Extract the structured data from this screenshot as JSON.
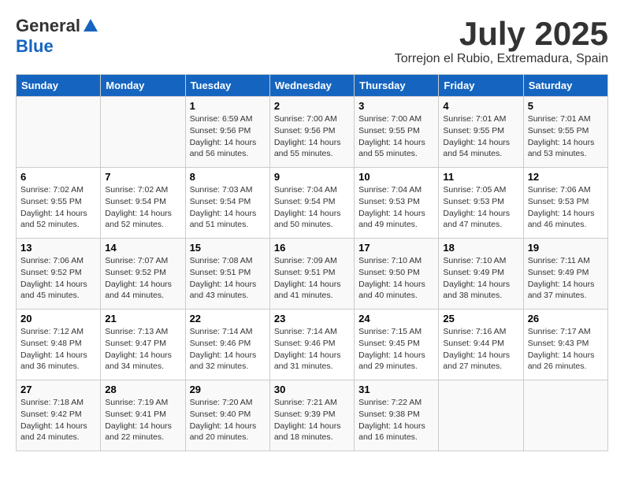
{
  "header": {
    "logo_general": "General",
    "logo_blue": "Blue",
    "month_title": "July 2025",
    "location": "Torrejon el Rubio, Extremadura, Spain"
  },
  "weekdays": [
    "Sunday",
    "Monday",
    "Tuesday",
    "Wednesday",
    "Thursday",
    "Friday",
    "Saturday"
  ],
  "weeks": [
    [
      {
        "day": "",
        "sunrise": "",
        "sunset": "",
        "daylight": ""
      },
      {
        "day": "",
        "sunrise": "",
        "sunset": "",
        "daylight": ""
      },
      {
        "day": "1",
        "sunrise": "Sunrise: 6:59 AM",
        "sunset": "Sunset: 9:56 PM",
        "daylight": "Daylight: 14 hours and 56 minutes."
      },
      {
        "day": "2",
        "sunrise": "Sunrise: 7:00 AM",
        "sunset": "Sunset: 9:56 PM",
        "daylight": "Daylight: 14 hours and 55 minutes."
      },
      {
        "day": "3",
        "sunrise": "Sunrise: 7:00 AM",
        "sunset": "Sunset: 9:55 PM",
        "daylight": "Daylight: 14 hours and 55 minutes."
      },
      {
        "day": "4",
        "sunrise": "Sunrise: 7:01 AM",
        "sunset": "Sunset: 9:55 PM",
        "daylight": "Daylight: 14 hours and 54 minutes."
      },
      {
        "day": "5",
        "sunrise": "Sunrise: 7:01 AM",
        "sunset": "Sunset: 9:55 PM",
        "daylight": "Daylight: 14 hours and 53 minutes."
      }
    ],
    [
      {
        "day": "6",
        "sunrise": "Sunrise: 7:02 AM",
        "sunset": "Sunset: 9:55 PM",
        "daylight": "Daylight: 14 hours and 52 minutes."
      },
      {
        "day": "7",
        "sunrise": "Sunrise: 7:02 AM",
        "sunset": "Sunset: 9:54 PM",
        "daylight": "Daylight: 14 hours and 52 minutes."
      },
      {
        "day": "8",
        "sunrise": "Sunrise: 7:03 AM",
        "sunset": "Sunset: 9:54 PM",
        "daylight": "Daylight: 14 hours and 51 minutes."
      },
      {
        "day": "9",
        "sunrise": "Sunrise: 7:04 AM",
        "sunset": "Sunset: 9:54 PM",
        "daylight": "Daylight: 14 hours and 50 minutes."
      },
      {
        "day": "10",
        "sunrise": "Sunrise: 7:04 AM",
        "sunset": "Sunset: 9:53 PM",
        "daylight": "Daylight: 14 hours and 49 minutes."
      },
      {
        "day": "11",
        "sunrise": "Sunrise: 7:05 AM",
        "sunset": "Sunset: 9:53 PM",
        "daylight": "Daylight: 14 hours and 47 minutes."
      },
      {
        "day": "12",
        "sunrise": "Sunrise: 7:06 AM",
        "sunset": "Sunset: 9:53 PM",
        "daylight": "Daylight: 14 hours and 46 minutes."
      }
    ],
    [
      {
        "day": "13",
        "sunrise": "Sunrise: 7:06 AM",
        "sunset": "Sunset: 9:52 PM",
        "daylight": "Daylight: 14 hours and 45 minutes."
      },
      {
        "day": "14",
        "sunrise": "Sunrise: 7:07 AM",
        "sunset": "Sunset: 9:52 PM",
        "daylight": "Daylight: 14 hours and 44 minutes."
      },
      {
        "day": "15",
        "sunrise": "Sunrise: 7:08 AM",
        "sunset": "Sunset: 9:51 PM",
        "daylight": "Daylight: 14 hours and 43 minutes."
      },
      {
        "day": "16",
        "sunrise": "Sunrise: 7:09 AM",
        "sunset": "Sunset: 9:51 PM",
        "daylight": "Daylight: 14 hours and 41 minutes."
      },
      {
        "day": "17",
        "sunrise": "Sunrise: 7:10 AM",
        "sunset": "Sunset: 9:50 PM",
        "daylight": "Daylight: 14 hours and 40 minutes."
      },
      {
        "day": "18",
        "sunrise": "Sunrise: 7:10 AM",
        "sunset": "Sunset: 9:49 PM",
        "daylight": "Daylight: 14 hours and 38 minutes."
      },
      {
        "day": "19",
        "sunrise": "Sunrise: 7:11 AM",
        "sunset": "Sunset: 9:49 PM",
        "daylight": "Daylight: 14 hours and 37 minutes."
      }
    ],
    [
      {
        "day": "20",
        "sunrise": "Sunrise: 7:12 AM",
        "sunset": "Sunset: 9:48 PM",
        "daylight": "Daylight: 14 hours and 36 minutes."
      },
      {
        "day": "21",
        "sunrise": "Sunrise: 7:13 AM",
        "sunset": "Sunset: 9:47 PM",
        "daylight": "Daylight: 14 hours and 34 minutes."
      },
      {
        "day": "22",
        "sunrise": "Sunrise: 7:14 AM",
        "sunset": "Sunset: 9:46 PM",
        "daylight": "Daylight: 14 hours and 32 minutes."
      },
      {
        "day": "23",
        "sunrise": "Sunrise: 7:14 AM",
        "sunset": "Sunset: 9:46 PM",
        "daylight": "Daylight: 14 hours and 31 minutes."
      },
      {
        "day": "24",
        "sunrise": "Sunrise: 7:15 AM",
        "sunset": "Sunset: 9:45 PM",
        "daylight": "Daylight: 14 hours and 29 minutes."
      },
      {
        "day": "25",
        "sunrise": "Sunrise: 7:16 AM",
        "sunset": "Sunset: 9:44 PM",
        "daylight": "Daylight: 14 hours and 27 minutes."
      },
      {
        "day": "26",
        "sunrise": "Sunrise: 7:17 AM",
        "sunset": "Sunset: 9:43 PM",
        "daylight": "Daylight: 14 hours and 26 minutes."
      }
    ],
    [
      {
        "day": "27",
        "sunrise": "Sunrise: 7:18 AM",
        "sunset": "Sunset: 9:42 PM",
        "daylight": "Daylight: 14 hours and 24 minutes."
      },
      {
        "day": "28",
        "sunrise": "Sunrise: 7:19 AM",
        "sunset": "Sunset: 9:41 PM",
        "daylight": "Daylight: 14 hours and 22 minutes."
      },
      {
        "day": "29",
        "sunrise": "Sunrise: 7:20 AM",
        "sunset": "Sunset: 9:40 PM",
        "daylight": "Daylight: 14 hours and 20 minutes."
      },
      {
        "day": "30",
        "sunrise": "Sunrise: 7:21 AM",
        "sunset": "Sunset: 9:39 PM",
        "daylight": "Daylight: 14 hours and 18 minutes."
      },
      {
        "day": "31",
        "sunrise": "Sunrise: 7:22 AM",
        "sunset": "Sunset: 9:38 PM",
        "daylight": "Daylight: 14 hours and 16 minutes."
      },
      {
        "day": "",
        "sunrise": "",
        "sunset": "",
        "daylight": ""
      },
      {
        "day": "",
        "sunrise": "",
        "sunset": "",
        "daylight": ""
      }
    ]
  ]
}
